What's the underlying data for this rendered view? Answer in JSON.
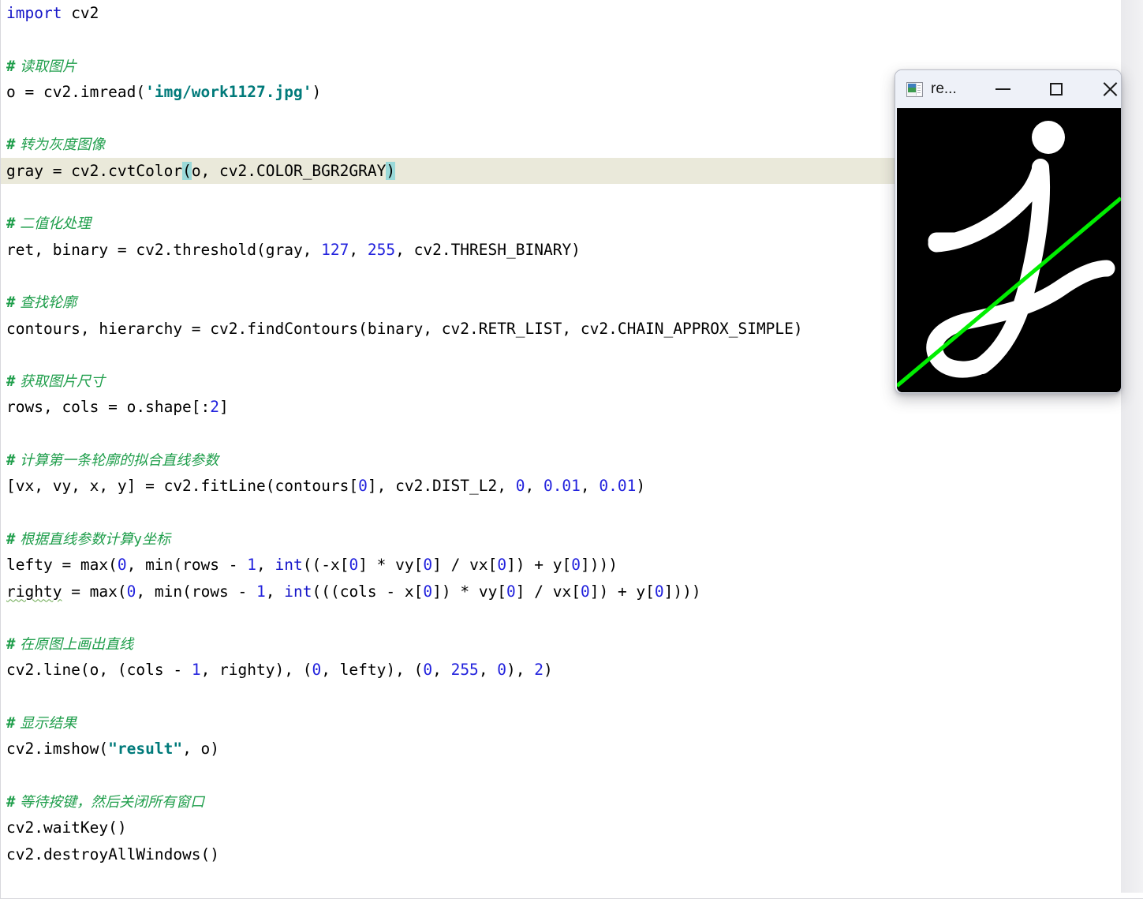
{
  "app": {
    "kind": "python-code-editor",
    "background_color": "#ffffff",
    "highlighted_line_color": "#eae9da",
    "brace_match_color": "#9ad9d9"
  },
  "colors": {
    "keyword": "#1414c8",
    "number": "#2222dd",
    "string": "#007a7a",
    "comment": "#1f9e4b",
    "text": "#000000",
    "line_fitted": "#00ff00",
    "image_background": "#000000",
    "image_stroke": "#ffffff"
  },
  "code": {
    "lines": [
      {
        "id": 1,
        "type": "code",
        "text": "import cv2"
      },
      {
        "id": 2,
        "type": "blank",
        "text": ""
      },
      {
        "id": 3,
        "type": "comment",
        "text": "# 读取图片"
      },
      {
        "id": 4,
        "type": "code",
        "text": "o = cv2.imread('img/work1127.jpg')"
      },
      {
        "id": 5,
        "type": "blank",
        "text": ""
      },
      {
        "id": 6,
        "type": "comment",
        "text": "# 转为灰度图像"
      },
      {
        "id": 7,
        "type": "code",
        "text": "gray = cv2.cvtColor(o, cv2.COLOR_BGR2GRAY)",
        "highlighted": true
      },
      {
        "id": 8,
        "type": "blank",
        "text": ""
      },
      {
        "id": 9,
        "type": "comment",
        "text": "# 二值化处理"
      },
      {
        "id": 10,
        "type": "code",
        "text": "ret, binary = cv2.threshold(gray, 127, 255, cv2.THRESH_BINARY)"
      },
      {
        "id": 11,
        "type": "blank",
        "text": ""
      },
      {
        "id": 12,
        "type": "comment",
        "text": "# 查找轮廓"
      },
      {
        "id": 13,
        "type": "code",
        "text": "contours, hierarchy = cv2.findContours(binary, cv2.RETR_LIST, cv2.CHAIN_APPROX_SIMPLE)"
      },
      {
        "id": 14,
        "type": "blank",
        "text": ""
      },
      {
        "id": 15,
        "type": "comment",
        "text": "# 获取图片尺寸"
      },
      {
        "id": 16,
        "type": "code",
        "text": "rows, cols = o.shape[:2]"
      },
      {
        "id": 17,
        "type": "blank",
        "text": ""
      },
      {
        "id": 18,
        "type": "comment",
        "text": "# 计算第一条轮廓的拟合直线参数"
      },
      {
        "id": 19,
        "type": "code",
        "text": "[vx, vy, x, y] = cv2.fitLine(contours[0], cv2.DIST_L2, 0, 0.01, 0.01)"
      },
      {
        "id": 20,
        "type": "blank",
        "text": ""
      },
      {
        "id": 21,
        "type": "comment",
        "text": "# 根据直线参数计算y坐标"
      },
      {
        "id": 22,
        "type": "code",
        "text": "lefty = max(0, min(rows - 1, int((-x[0] * vy[0] / vx[0]) + y[0])))"
      },
      {
        "id": 23,
        "type": "code",
        "text": "righty = max(0, min(rows - 1, int(((cols - x[0]) * vy[0] / vx[0]) + y[0])))",
        "spellcheck_word": "righty"
      },
      {
        "id": 24,
        "type": "blank",
        "text": ""
      },
      {
        "id": 25,
        "type": "comment",
        "text": "# 在原图上画出直线"
      },
      {
        "id": 26,
        "type": "code",
        "text": "cv2.line(o, (cols - 1, righty), (0, lefty), (0, 255, 0), 2)"
      },
      {
        "id": 27,
        "type": "blank",
        "text": ""
      },
      {
        "id": 28,
        "type": "comment",
        "text": "# 显示结果"
      },
      {
        "id": 29,
        "type": "code",
        "text": "cv2.imshow(\"result\", o)"
      },
      {
        "id": 30,
        "type": "blank",
        "text": ""
      },
      {
        "id": 31,
        "type": "comment",
        "text": "# 等待按键，然后关闭所有窗口"
      },
      {
        "id": 32,
        "type": "code",
        "text": "cv2.waitKey()"
      },
      {
        "id": 33,
        "type": "code",
        "text": "cv2.destroyAllWindows()"
      }
    ]
  },
  "image_window": {
    "title": "re...",
    "icon": "picture-icon",
    "minimize_label": "—",
    "maximize_label": "□",
    "close_label": "✕",
    "content_description": "Handwritten white stroke on black background with a green fitted line drawn diagonally from lower-left to upper-right"
  }
}
